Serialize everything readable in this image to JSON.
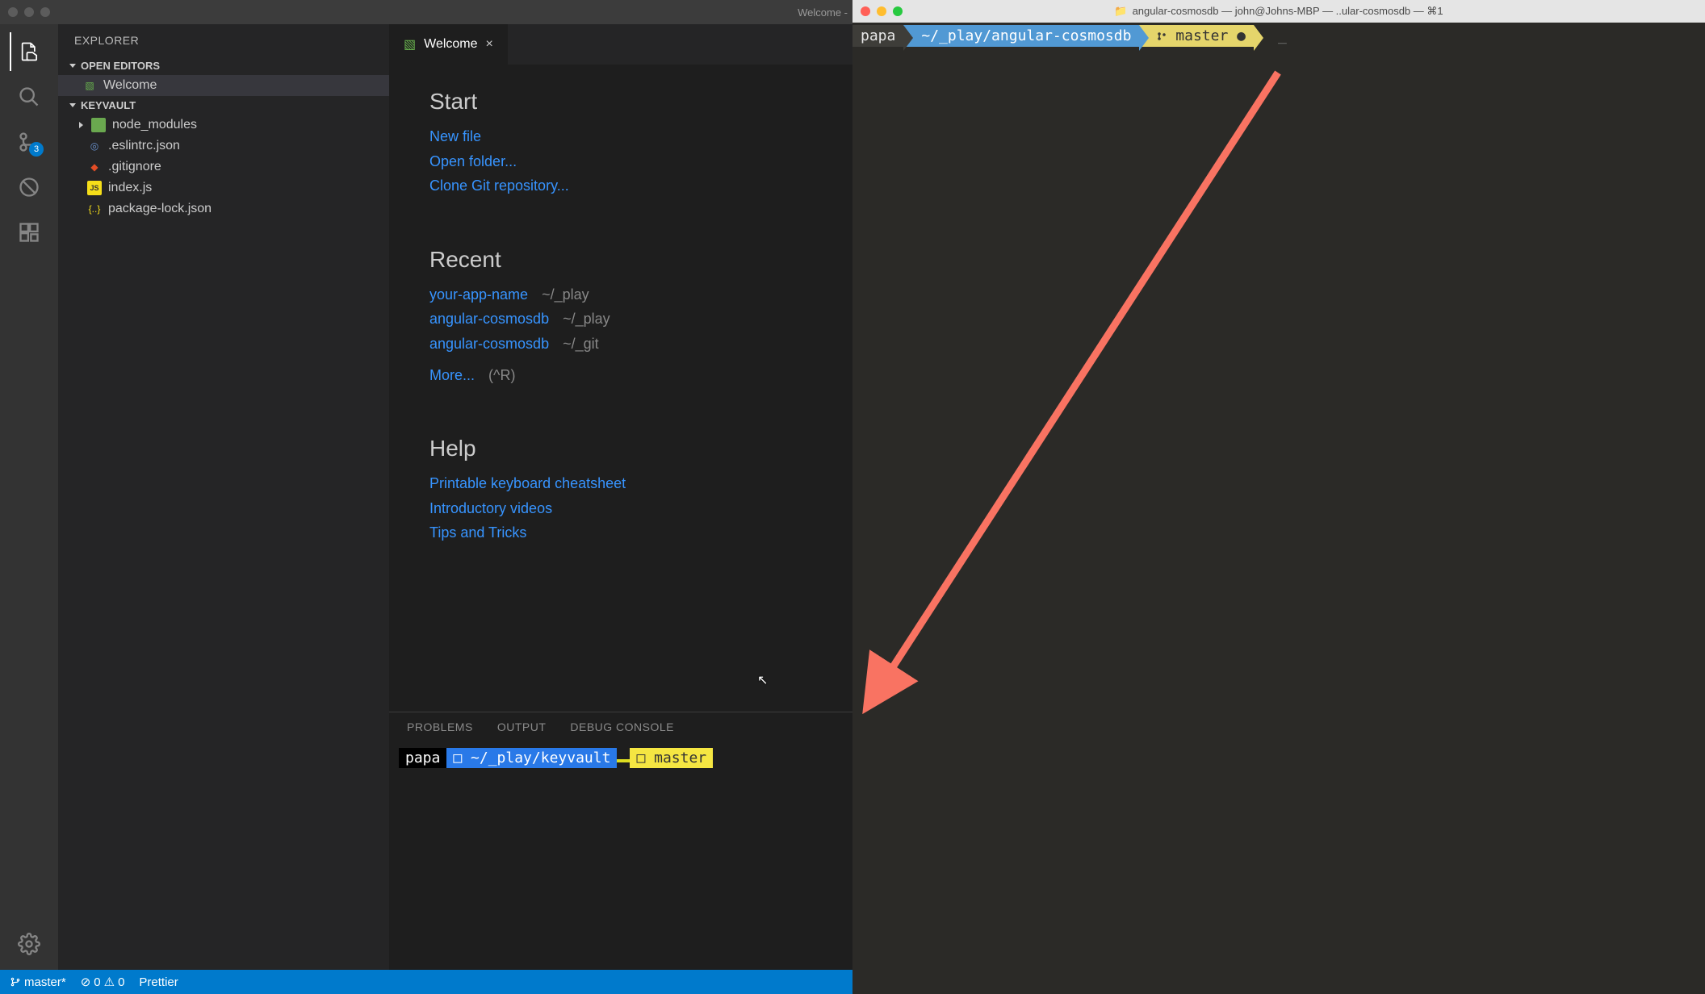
{
  "vscode": {
    "titlebar": "Welcome -",
    "sidebar": {
      "title": "EXPLORER",
      "sections": {
        "openEditors": "OPEN EDITORS",
        "project": "KEYVAULT"
      },
      "openItems": [
        {
          "label": "Welcome"
        }
      ],
      "files": [
        {
          "label": "node_modules",
          "icon": "folder"
        },
        {
          "label": ".eslintrc.json",
          "icon": "target"
        },
        {
          "label": ".gitignore",
          "icon": "git"
        },
        {
          "label": "index.js",
          "icon": "js"
        },
        {
          "label": "package-lock.json",
          "icon": "json"
        }
      ]
    },
    "tab": {
      "label": "Welcome"
    },
    "welcome": {
      "startTitle": "Start",
      "startLinks": [
        "New file",
        "Open folder...",
        "Clone Git repository..."
      ],
      "recentTitle": "Recent",
      "recentItems": [
        {
          "name": "your-app-name",
          "path": "~/_play"
        },
        {
          "name": "angular-cosmosdb",
          "path": "~/_play"
        },
        {
          "name": "angular-cosmosdb",
          "path": "~/_git"
        }
      ],
      "moreLabel": "More...",
      "moreShortcut": "(^R)",
      "helpTitle": "Help",
      "helpLinks": [
        "Printable keyboard cheatsheet",
        "Introductory videos",
        "Tips and Tricks"
      ]
    },
    "panel": {
      "tabs": [
        "PROBLEMS",
        "OUTPUT",
        "DEBUG CONSOLE"
      ],
      "prompt": {
        "user": "papa",
        "path": "□ ~/_play/keyvault",
        "branch": "□ master"
      }
    },
    "status": {
      "branch": "master*",
      "errors": "0",
      "warnings": "0",
      "formatter": "Prettier"
    },
    "scmBadge": "3"
  },
  "terminal": {
    "title": "angular-cosmosdb — john@Johns-MBP — ..ular-cosmosdb — ⌘1",
    "prompt": {
      "user": "papa",
      "path": "~/_play/angular-cosmosdb",
      "branch": "master",
      "dirty": "●"
    }
  }
}
